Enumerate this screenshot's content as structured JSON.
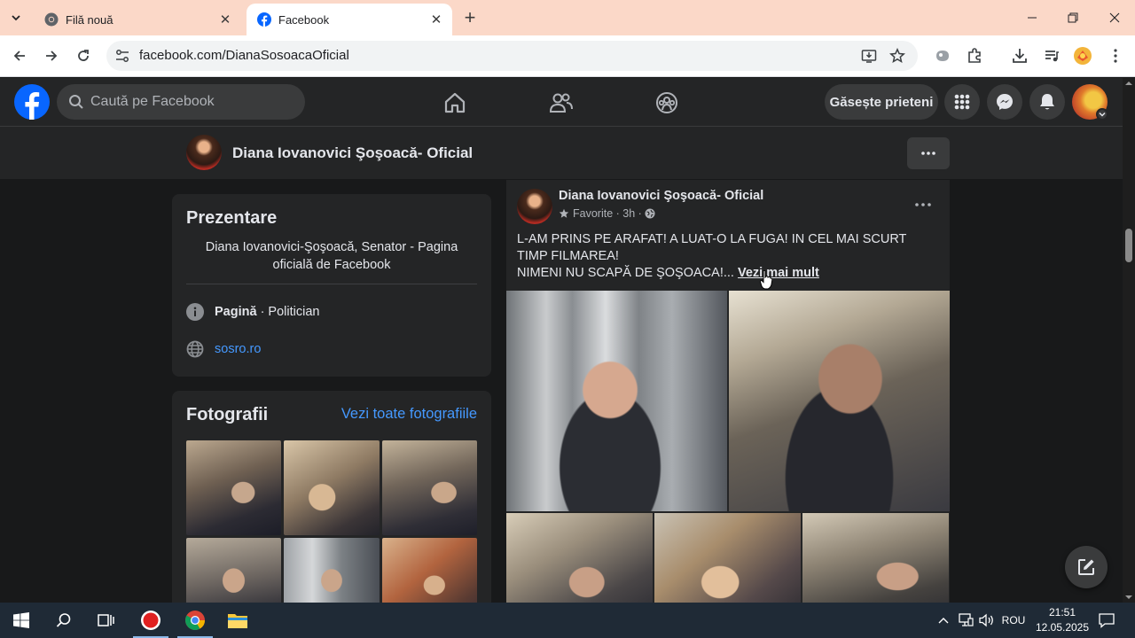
{
  "browser": {
    "tabs": [
      {
        "title": "Filă nouă",
        "active": false
      },
      {
        "title": "Facebook",
        "active": true
      }
    ],
    "url": "facebook.com/DianaSosoacaOficial"
  },
  "header": {
    "search_placeholder": "Caută pe Facebook",
    "find_friends_label": "Găsește prieteni"
  },
  "page": {
    "name": "Diana Iovanovici Şoşoacă- Oficial"
  },
  "intro": {
    "title": "Prezentare",
    "bio": "Diana Iovanovici-Şoşoacă, Senator - Pagina oficială de Facebook",
    "category_bold": "Pagină",
    "category_rest": " · Politician",
    "website": "sosro.ro"
  },
  "photos": {
    "title": "Fotografii",
    "see_all": "Vezi toate fotografiile"
  },
  "post": {
    "author": "Diana Iovanovici Şoşoacă- Oficial",
    "favorite_label": "Favorite",
    "time": "3h",
    "text_line1": "L-AM PRINS PE ARAFAT! A LUAT-O LA FUGA! IN CEL MAI SCURT TIMP FILMAREA!",
    "text_line2": "NIMENI NU SCAPĂ DE ŞOŞOACA!...",
    "see_more": "Vezi mai mult"
  },
  "taskbar": {
    "language": "ROU",
    "time": "21:51",
    "date": "12.05.2025"
  },
  "colors": {
    "fb_blue": "#0866ff",
    "link_blue": "#4599ff",
    "tabstrip": "#fbd8c8",
    "fb_bg": "#18191a",
    "card_bg": "#242526"
  }
}
